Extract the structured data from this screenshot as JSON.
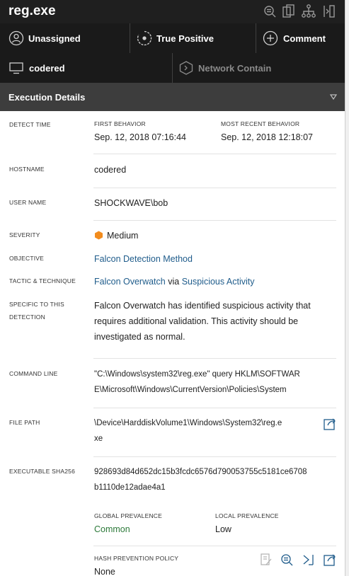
{
  "window": {
    "title": "reg.exe",
    "toolbar_icons": [
      "search-list-icon",
      "copy-icon",
      "process-tree-icon",
      "panel-collapse-icon"
    ]
  },
  "actions": [
    {
      "label": "Unassigned",
      "icon": "user-circle-icon",
      "enabled": true
    },
    {
      "label": "True Positive",
      "icon": "status-circle-icon",
      "enabled": true
    },
    {
      "label": "Comment",
      "icon": "add-circle-icon",
      "enabled": true
    }
  ],
  "secondary_actions": [
    {
      "label": "codered",
      "icon": "computer-icon",
      "enabled": true
    },
    {
      "label": "Network Contain",
      "icon": "network-contain-icon",
      "enabled": false
    }
  ],
  "section": {
    "title": "Execution Details"
  },
  "details": {
    "detect_time": {
      "label": "DETECT TIME",
      "first_behavior_label": "FIRST BEHAVIOR",
      "first_behavior": "Sep. 12, 2018 07:16:44",
      "recent_behavior_label": "MOST RECENT BEHAVIOR",
      "recent_behavior": "Sep. 12, 2018 12:18:07"
    },
    "hostname": {
      "label": "HOSTNAME",
      "value": "codered"
    },
    "user_name": {
      "label": "USER NAME",
      "value": "SHOCKWAVE\\bob"
    },
    "severity": {
      "label": "SEVERITY",
      "value": "Medium",
      "color": "#f28c1e"
    },
    "objective": {
      "label": "OBJECTIVE",
      "value": "Falcon Detection Method"
    },
    "tactic": {
      "label": "TACTIC & TECHNIQUE",
      "tactic": "Falcon Overwatch",
      "via": "via",
      "technique": "Suspicious Activity"
    },
    "specific": {
      "label_line1": "SPECIFIC TO THIS",
      "label_line2": "DETECTION",
      "lines": [
        "Falcon Overwatch has identified suspicious activity that",
        "requires additional validation. This activity should be",
        "investigated as normal."
      ]
    },
    "command_line": {
      "label": "COMMAND LINE",
      "lines": [
        "\"C:\\Windows\\system32\\reg.exe\" query HKLM\\SOFTWAR",
        "E\\Microsoft\\Windows\\CurrentVersion\\Policies\\System"
      ]
    },
    "file_path": {
      "label": "FILE PATH",
      "lines": [
        "\\Device\\HarddiskVolume1\\Windows\\System32\\reg.e",
        "xe"
      ]
    },
    "sha256": {
      "label": "EXECUTABLE SHA256",
      "lines": [
        "928693d84d652dc15b3fcdc6576d790053755c5181ce6708",
        "b1110de12adae4a1"
      ],
      "global_label": "GLOBAL PREVALENCE",
      "global_value": "Common",
      "local_label": "LOCAL PREVALENCE",
      "local_value": "Low",
      "policy_label": "HASH PREVENTION POLICY",
      "policy_value": "None"
    }
  }
}
